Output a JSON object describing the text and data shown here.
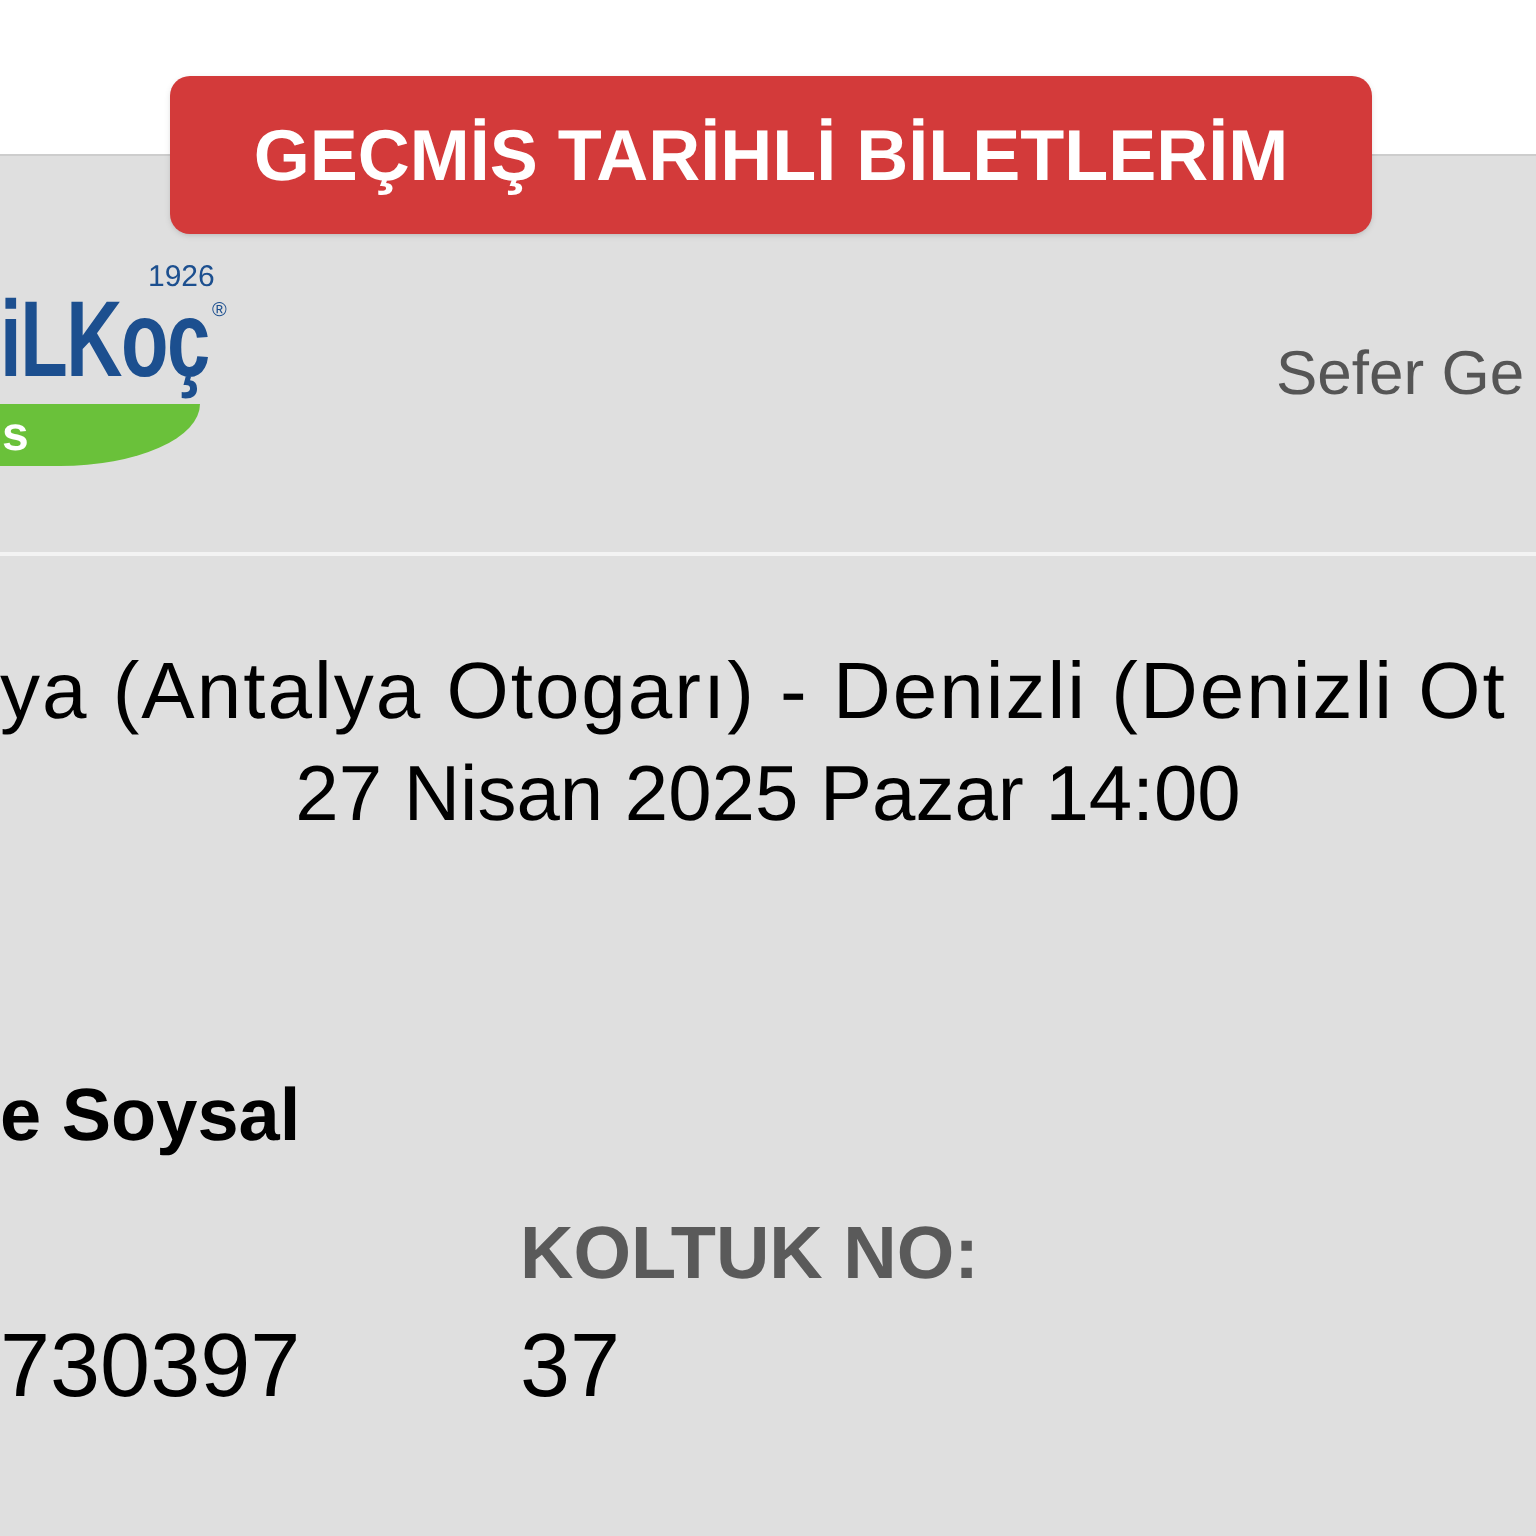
{
  "header_badge": {
    "label": "GEÇMİŞ TARİHLİ BİLETLERİM"
  },
  "ticket": {
    "logo": {
      "year": "1926",
      "wordmark": "iLKoç",
      "registered_mark": "®",
      "band_text": "s"
    },
    "trip_date_label": "Sefer Ge",
    "route": "ya (Antalya Otogarı) - Denizli (Denizli Ot",
    "departure": "27 Nisan 2025 Pazar 14:00",
    "passenger_name": "e Soysal",
    "fields": [
      {
        "value": "730397"
      },
      {
        "label": "KOLTUK NO:",
        "value": "37"
      }
    ]
  }
}
